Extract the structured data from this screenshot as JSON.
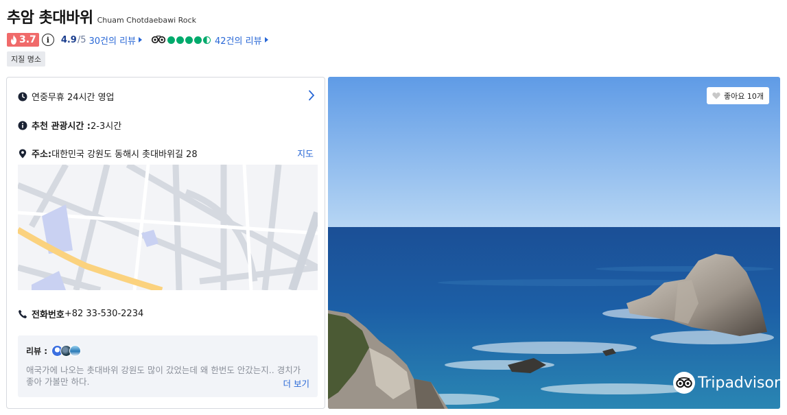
{
  "attraction": {
    "title": "추암 촛대바위",
    "subtitle": "Chuam Chotdaebawi Rock",
    "hot_score": "3.7",
    "info_symbol": "i",
    "score": "4.9",
    "score_max": "/5",
    "review_count_label": "30건의 리뷰",
    "tripadvisor_bubbles": 4.5,
    "tripadvisor_review_label": "42건의 리뷰",
    "tag": "지질 명소"
  },
  "details": {
    "hours": "연중무휴 24시간 영업",
    "duration_label": "추천 관광시간 :",
    "duration_value": "2-3시간",
    "address_label": "주소:",
    "address_value": "대한민국 강원도 동해시 촛대바위길 28",
    "map_link": "지도",
    "phone_label": "전화번호",
    "phone_value": "+82 33-530-2234"
  },
  "review": {
    "label": "리뷰 :",
    "text": "애국가에 나오는 촛대바위 강원도 많이 갔었는데 왜 한번도 안갔는지.. 경치가 좋아 가볼만 하다.",
    "more": "더 보기"
  },
  "photo": {
    "like_label": "좋아요 10개",
    "watermark": "Tripadvisor"
  },
  "colors": {
    "accent_blue": "#2867d6",
    "hot_red": "#f06a6a",
    "ta_green": "#00aa6c",
    "score_navy": "#1b3e8e"
  },
  "icons": [
    "fire-icon",
    "info-icon",
    "tripadvisor-owl-icon",
    "clock-icon",
    "chevron-right-icon",
    "location-pin-icon",
    "phone-icon",
    "heart-icon"
  ]
}
